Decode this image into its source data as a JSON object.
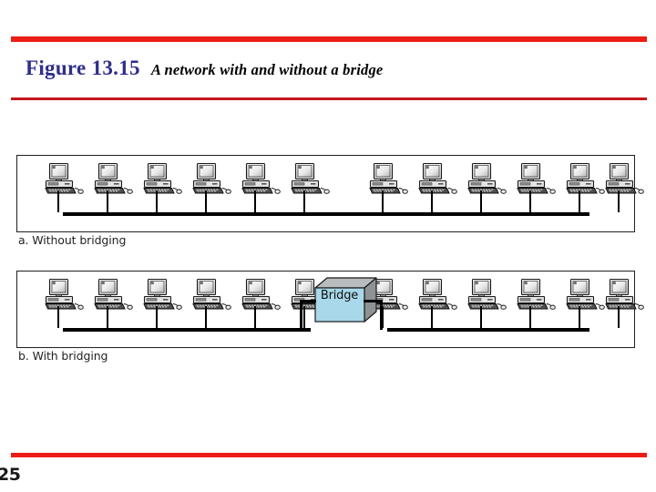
{
  "slide": {
    "figure_number": "Figure 13.15",
    "figure_caption": "A network with and without a bridge",
    "page_number": "25",
    "accent_color_primary": "#ED1C16",
    "accent_color_secondary": "#C4161C",
    "figure_number_color": "#2E2E8B"
  },
  "panels": [
    {
      "id": "a",
      "caption": "a. Without bridging",
      "left_group_count": 6,
      "right_group_count": 6,
      "bus_segments": 1,
      "has_bridge": false
    },
    {
      "id": "b",
      "caption": "b. With bridging",
      "left_group_count": 6,
      "right_group_count": 6,
      "bus_segments": 2,
      "has_bridge": true,
      "bridge_label": "Bridge",
      "bridge_face_color": "#A8D8EA",
      "bridge_top_color": "#B9BCBE",
      "bridge_side_color": "#8F9295"
    }
  ],
  "icons": {
    "computer": "computer-icon",
    "bridge": "bridge-device-icon"
  }
}
